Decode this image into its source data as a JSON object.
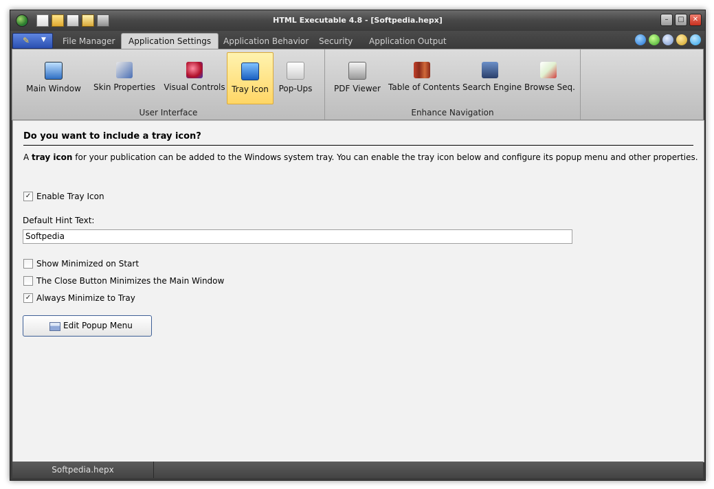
{
  "window": {
    "title": "HTML Executable 4.8 - [Softpedia.hepx]",
    "controls": [
      "minimize",
      "maximize",
      "close"
    ]
  },
  "quick_access": [
    "new-icon",
    "open-icon",
    "save-icon",
    "build-icon",
    "test-icon"
  ],
  "tabs": [
    {
      "label": "File Manager"
    },
    {
      "label": "Application Settings"
    },
    {
      "label": "Application Behavior"
    },
    {
      "label": "Security"
    },
    {
      "label": "Application Output"
    }
  ],
  "active_tab": "Application Settings",
  "help_icons": [
    "help-icon",
    "update-icon",
    "users-icon",
    "award-icon",
    "twitter-icon"
  ],
  "ribbon": {
    "groups": [
      {
        "label": "User Interface",
        "buttons": [
          {
            "label": "Main Window",
            "icon": "monitor-icon"
          },
          {
            "label": "Skin Properties",
            "icon": "brush-icon"
          },
          {
            "label": "Visual Controls",
            "icon": "controls-icon"
          },
          {
            "label": "Tray Icon",
            "icon": "tray-icon"
          },
          {
            "label": "Pop-Ups",
            "icon": "popups-icon"
          }
        ]
      },
      {
        "label": "Enhance Navigation",
        "buttons": [
          {
            "label": "PDF Viewer",
            "icon": "pdf-icon"
          },
          {
            "label": "Table of Contents",
            "icon": "books-icon"
          },
          {
            "label": "Search Engine",
            "icon": "search-engine-icon"
          },
          {
            "label": "Browse Seq.",
            "icon": "browse-sequence-icon"
          }
        ]
      }
    ],
    "selected": "Tray Icon"
  },
  "content": {
    "heading": "Do you want to include a tray icon?",
    "desc_prefix": "A ",
    "desc_bold": "tray icon",
    "desc_suffix": " for your publication can be added to the Windows system tray. You can enable the tray icon below and configure its popup menu and other properties.",
    "enable_tray": {
      "label": "Enable Tray Icon",
      "checked": true
    },
    "hint_label": "Default Hint Text:",
    "hint_value": "Softpedia",
    "options": [
      {
        "label": "Show Minimized on Start",
        "checked": false
      },
      {
        "label": "The Close Button Minimizes the Main Window",
        "checked": false
      },
      {
        "label": "Always Minimize to Tray",
        "checked": true
      }
    ],
    "popup_button": "Edit Popup Menu"
  },
  "status": {
    "file": "Softpedia.hepx"
  },
  "colors": {
    "ribbon_selected": "#ffd665",
    "titlebar": "#474747",
    "accent": "#2a4fb0"
  }
}
